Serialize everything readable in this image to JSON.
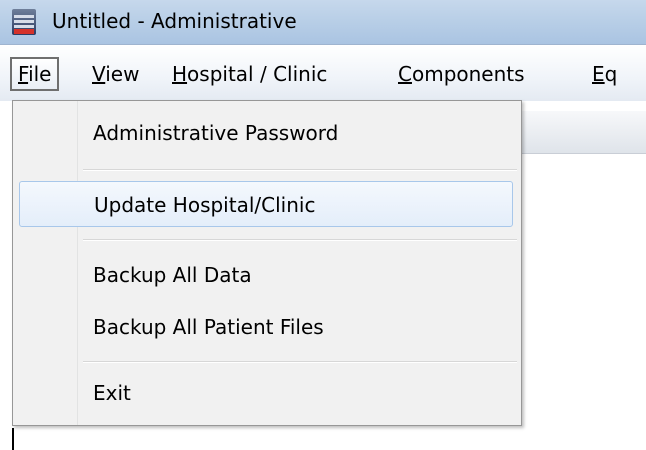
{
  "window": {
    "title": "Untitled - Administrative"
  },
  "menubar": {
    "items": [
      {
        "label": "File",
        "mnemonic": "F",
        "rest": "ile"
      },
      {
        "label": "View",
        "mnemonic": "V",
        "rest": "iew"
      },
      {
        "label": "Hospital / Clinic",
        "mnemonic": "H",
        "rest": "ospital / Clinic"
      },
      {
        "label": "Components",
        "mnemonic": "C",
        "rest": "omponents"
      },
      {
        "label": "Eq",
        "mnemonic": "E",
        "rest": "q"
      }
    ]
  },
  "file_menu": {
    "items": [
      {
        "label": "Administrative Password"
      },
      {
        "label": "Update Hospital/Clinic",
        "highlighted": true
      },
      {
        "label": "Backup All Data"
      },
      {
        "label": "Backup All Patient Files"
      },
      {
        "label": "Exit"
      }
    ]
  },
  "colors": {
    "titlebar": "#b9cfe7",
    "highlight_border": "#a8c7ea",
    "menu_background": "#f1f1f1"
  }
}
